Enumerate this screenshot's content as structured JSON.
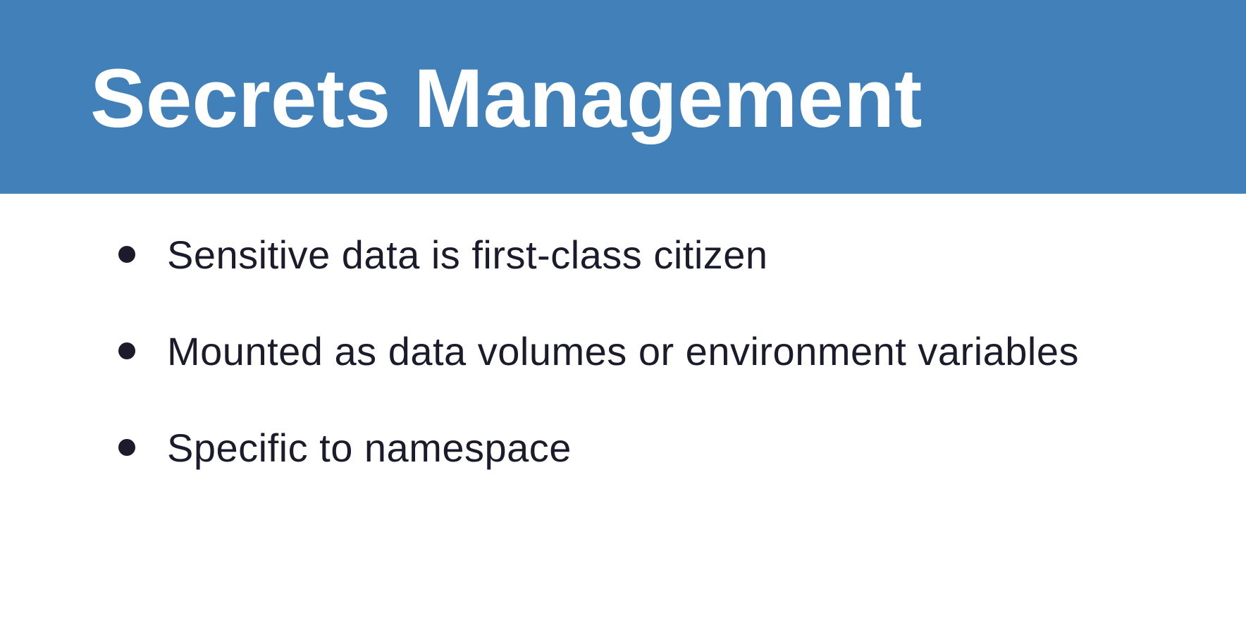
{
  "slide": {
    "title": "Secrets Management",
    "header_color": "#4180b8",
    "text_color": "#1b1b2b",
    "bullets": [
      {
        "text": "Sensitive data is first-class citizen"
      },
      {
        "text": "Mounted as data volumes or environment variables"
      },
      {
        "text": "Specific to namespace"
      }
    ]
  }
}
